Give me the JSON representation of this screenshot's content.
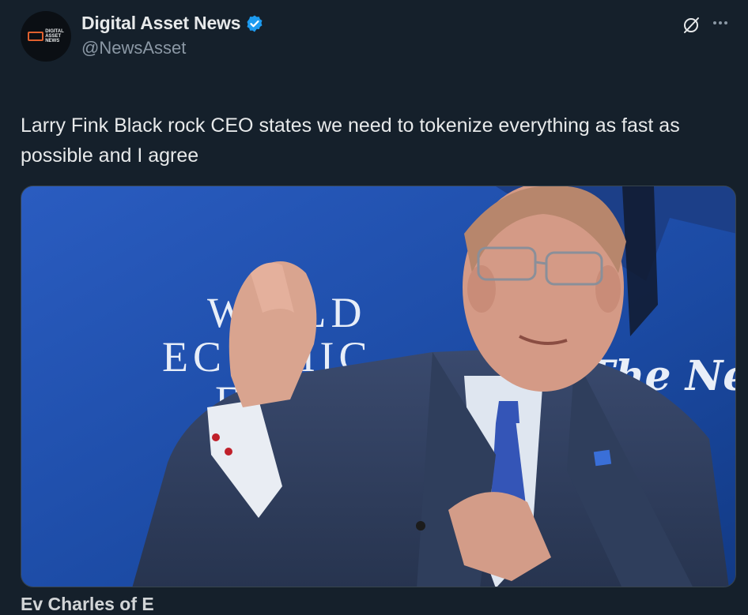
{
  "author": {
    "display_name": "Digital Asset News",
    "handle": "@NewsAsset",
    "avatar_text": [
      "DIGITAL",
      "ASSET",
      "NEWS"
    ],
    "verified": true
  },
  "tweet": {
    "text": "Larry Fink Black rock CEO states we need to tokenize everything as fast as possible and I agree"
  },
  "media": {
    "type": "video-frame",
    "backdrop_lettering": [
      "W  RLD",
      "EC  OMIC",
      "F  R"
    ],
    "right_lettering": "The Ne"
  },
  "next_tweet_partial": "Ev   Charles of E",
  "icons": {
    "verified": "verified-badge-icon",
    "grok": "grok-icon",
    "more": "more-icon"
  },
  "colors": {
    "background": "#15202b",
    "text_primary": "#e7e9ea",
    "text_secondary": "#8b98a5",
    "verified_blue": "#1d9bf0",
    "border": "#38444d"
  }
}
